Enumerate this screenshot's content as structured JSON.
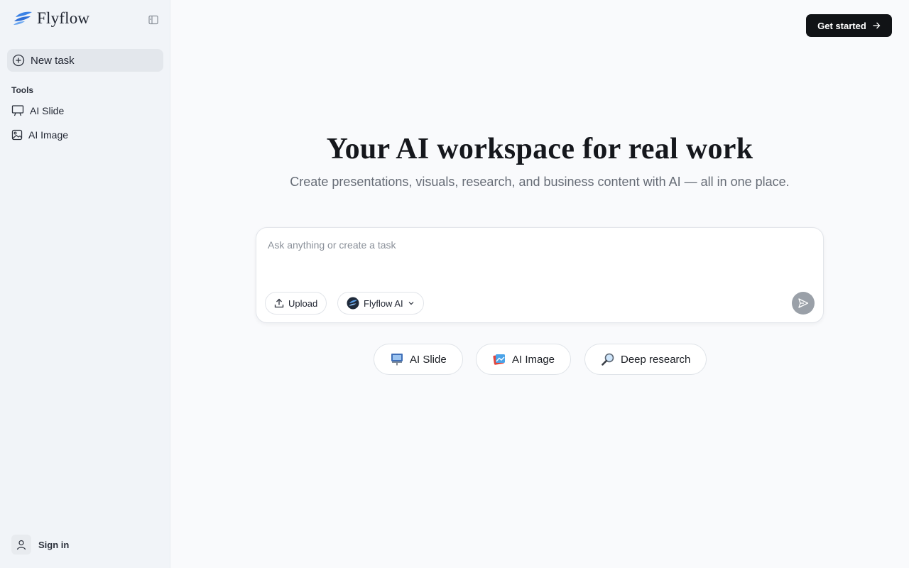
{
  "brand": {
    "name": "Flyflow"
  },
  "sidebar": {
    "new_task": "New task",
    "section_label": "Tools",
    "tools": [
      {
        "label": "AI Slide",
        "icon": "presentation-icon"
      },
      {
        "label": "AI Image",
        "icon": "image-icon"
      }
    ],
    "sign_in": "Sign in"
  },
  "header": {
    "get_started": "Get started"
  },
  "hero": {
    "title": "Your AI workspace for real work",
    "subtitle": "Create presentations, visuals, research, and business content with AI — all in one place."
  },
  "prompt": {
    "placeholder": "Ask anything or create a task",
    "upload_label": "Upload",
    "model_label": "Flyflow AI"
  },
  "quick_actions": [
    {
      "label": "AI Slide",
      "icon": "slide-emoji-icon"
    },
    {
      "label": "AI Image",
      "icon": "image-emoji-icon"
    },
    {
      "label": "Deep research",
      "icon": "magnifier-emoji-icon"
    }
  ],
  "colors": {
    "sidebar_bg": "#f1f4f8",
    "page_bg": "#f9fafc",
    "primary_button": "#111316",
    "send_button": "#9aa0a8",
    "brand_blue": "#2f6fd6"
  }
}
